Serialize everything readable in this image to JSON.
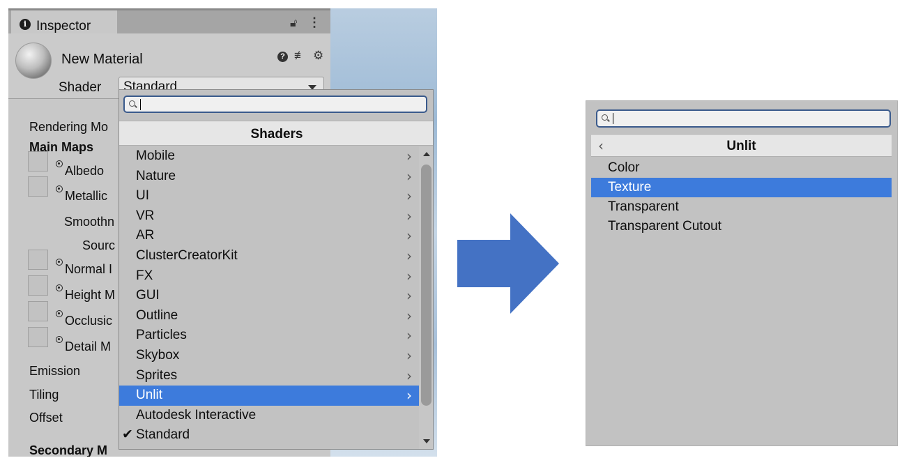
{
  "inspector": {
    "tab_label": "Inspector",
    "material_name": "New Material",
    "shader_label": "Shader",
    "shader_value": "Standard",
    "properties": {
      "rendering_mode": "Rendering Mo",
      "main_maps": "Main Maps",
      "albedo": "Albedo",
      "metallic": "Metallic",
      "smoothness": "Smoothn",
      "source": "Sourc",
      "normal_map": "Normal I",
      "height_map": "Height M",
      "occlusion": "Occlusic",
      "detail_mask": "Detail M",
      "emission": "Emission",
      "tiling": "Tiling",
      "offset": "Offset",
      "secondary_maps": "Secondary M"
    }
  },
  "dropdown": {
    "search_value": "",
    "title": "Shaders",
    "items": [
      {
        "label": "Mobile",
        "submenu": true
      },
      {
        "label": "Nature",
        "submenu": true
      },
      {
        "label": "UI",
        "submenu": true
      },
      {
        "label": "VR",
        "submenu": true
      },
      {
        "label": "AR",
        "submenu": true
      },
      {
        "label": "ClusterCreatorKit",
        "submenu": true
      },
      {
        "label": "FX",
        "submenu": true
      },
      {
        "label": "GUI",
        "submenu": true
      },
      {
        "label": "Outline",
        "submenu": true
      },
      {
        "label": "Particles",
        "submenu": true
      },
      {
        "label": "Skybox",
        "submenu": true
      },
      {
        "label": "Sprites",
        "submenu": true
      },
      {
        "label": "Unlit",
        "submenu": true,
        "selected": true
      },
      {
        "label": "Autodesk Interactive",
        "submenu": false
      },
      {
        "label": "Standard",
        "submenu": false,
        "checked": true
      }
    ],
    "check_mark": "✔",
    "chevron": "›"
  },
  "submenu_panel": {
    "search_value": "",
    "back_glyph": "‹",
    "title": "Unlit",
    "items": [
      {
        "label": "Color"
      },
      {
        "label": "Texture",
        "selected": true
      },
      {
        "label": "Transparent"
      },
      {
        "label": "Transparent Cutout"
      }
    ]
  },
  "colors": {
    "selection": "#3d7bdc",
    "arrow": "#4472c4",
    "panel_bg": "#c2c2c2"
  }
}
